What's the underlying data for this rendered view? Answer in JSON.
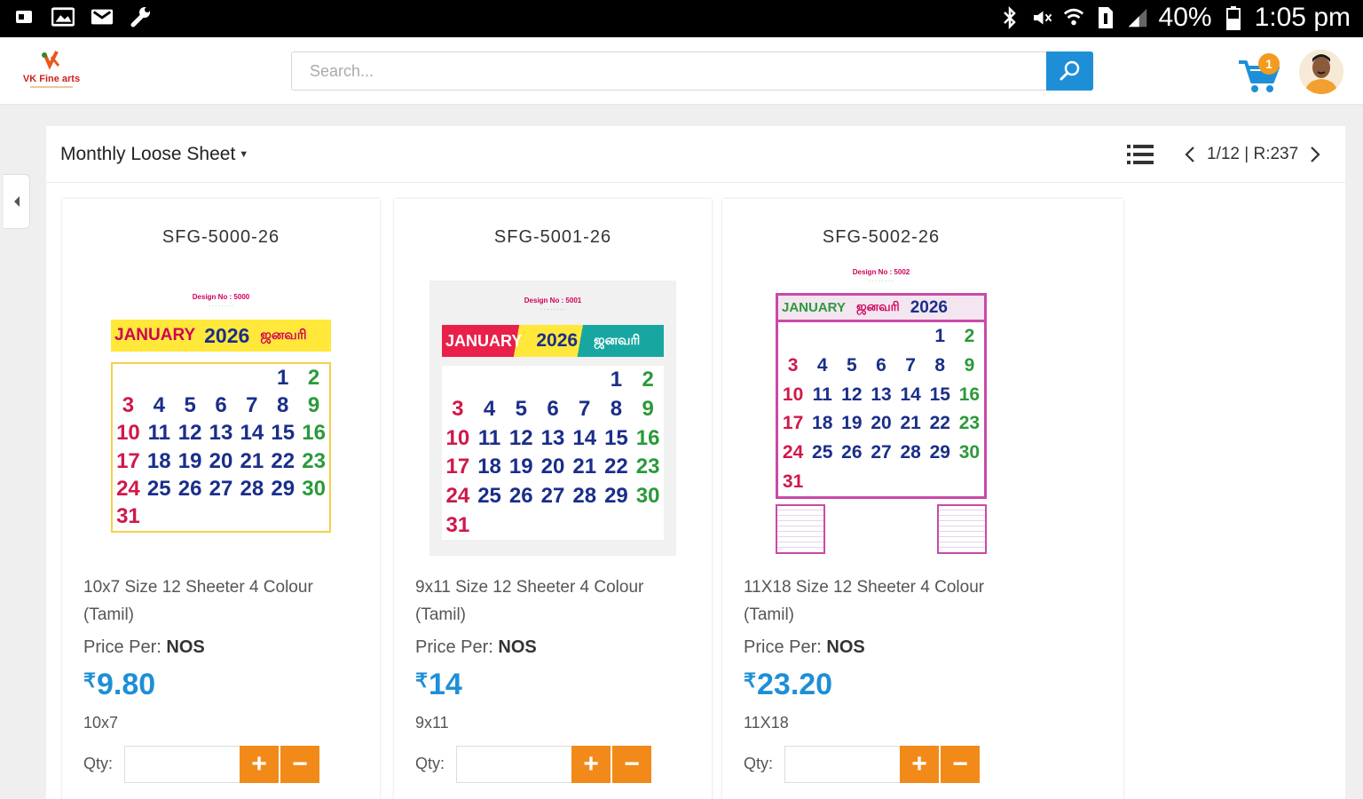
{
  "status_bar": {
    "battery": "40%",
    "time": "1:05 pm"
  },
  "header": {
    "logo_text": "VK Fine arts",
    "search_placeholder": "Search...",
    "cart_count": "1"
  },
  "toolbar": {
    "category": "Monthly Loose Sheet",
    "pager": "1/12 | R:237"
  },
  "products": [
    {
      "code": "SFG-5000-26",
      "name": "10x7 Size 12 Sheeter 4 Colour (Tamil)",
      "price_per_label": "Price Per:",
      "price_per_unit": "NOS",
      "currency": "₹",
      "price": "9.80",
      "size": "10x7",
      "qty_label": "Qty:",
      "qty_value": "",
      "plus": "+",
      "minus": "−",
      "img": {
        "design": "Design No : 5000",
        "month_en": "JANUARY",
        "year": "2026",
        "month_ta": "ஜனவரி"
      }
    },
    {
      "code": "SFG-5001-26",
      "name": "9x11 Size 12 Sheeter 4 Colour (Tamil)",
      "price_per_label": "Price Per:",
      "price_per_unit": "NOS",
      "currency": "₹",
      "price": "14",
      "size": "9x11",
      "qty_label": "Qty:",
      "qty_value": "",
      "plus": "+",
      "minus": "−",
      "img": {
        "design": "Design No : 5001",
        "month_en": "JANUARY",
        "year": "2026",
        "month_ta": "ஜனவரி"
      }
    },
    {
      "code": "SFG-5002-26",
      "name": "11X18 Size 12 Sheeter 4 Colour (Tamil)",
      "price_per_label": "Price Per:",
      "price_per_unit": "NOS",
      "currency": "₹",
      "price": "23.20",
      "size": "11X18",
      "qty_label": "Qty:",
      "qty_value": "",
      "plus": "+",
      "minus": "−",
      "img": {
        "design": "Design No : 5002",
        "month_en": "JANUARY",
        "year": "2026",
        "month_ta": "ஜனவரி"
      }
    }
  ],
  "calendar_days": [
    "",
    "",
    "",
    "",
    "",
    "",
    "",
    "",
    "",
    "",
    "",
    "",
    "2",
    "3",
    "4",
    "5",
    "6",
    "7",
    "8",
    "9",
    "10",
    "11",
    "12",
    "13",
    "14",
    "15",
    "16",
    "17",
    "18",
    "19",
    "20",
    "21",
    "22",
    "23",
    "24",
    "25",
    "26",
    "27",
    "28",
    "29",
    "30",
    "31"
  ],
  "colors": {
    "accent": "#1e8fd6",
    "button": "#f28a1a",
    "badge": "#f39a1f"
  }
}
